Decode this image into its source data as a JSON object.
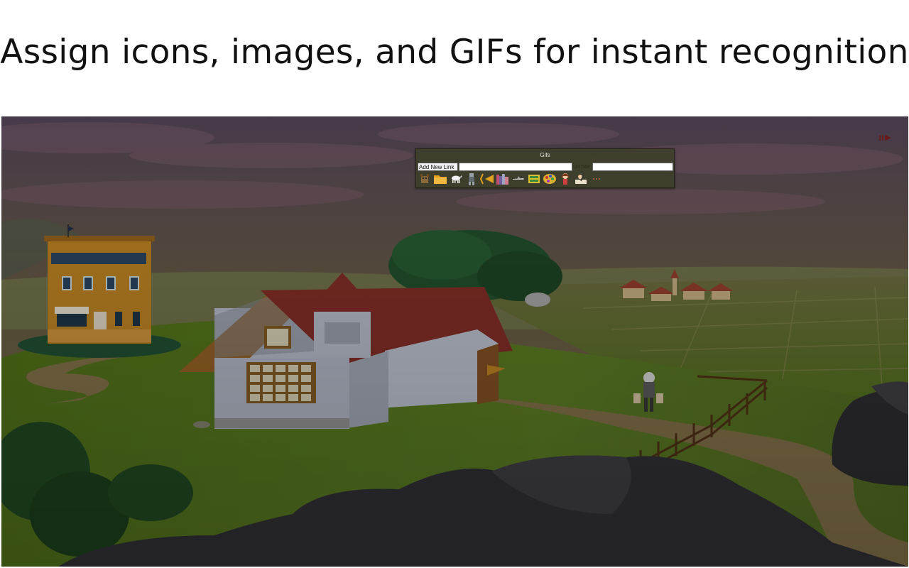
{
  "headline": "Assign icons, images, and GIFs for instant recognition",
  "panel": {
    "title": "Gifs",
    "add_link_label": "Add New Link",
    "title_label": "Url Title",
    "gifs": [
      {
        "name": "animal-gif-icon"
      },
      {
        "name": "folder-gif-icon"
      },
      {
        "name": "horse-gif-icon"
      },
      {
        "name": "robot-gif-icon"
      },
      {
        "name": "arrow-gif-icon"
      },
      {
        "name": "books-gif-icon"
      },
      {
        "name": "plane-gif-icon"
      },
      {
        "name": "cash-gif-icon"
      },
      {
        "name": "palette-gif-icon"
      },
      {
        "name": "girl-gif-icon"
      },
      {
        "name": "writer-gif-icon"
      },
      {
        "name": "more-gif-icon"
      }
    ]
  },
  "colors": {
    "sky_top": "#4a3d4e",
    "sky_horizon": "#6e6a3a",
    "grass": "#4f6a1c",
    "rocks": "#2a2a2e"
  }
}
